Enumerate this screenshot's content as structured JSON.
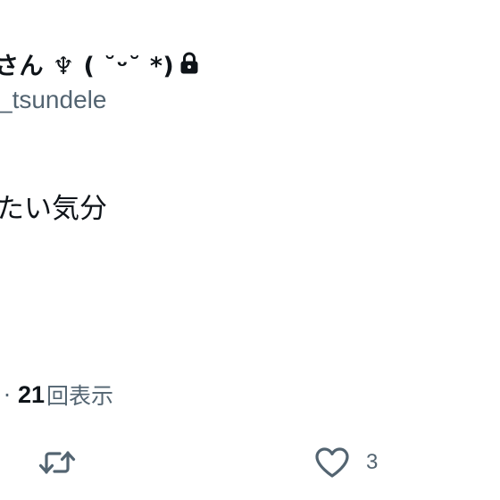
{
  "profile": {
    "display_name": "さん ♆ ( ˘ᵕ˘ *)",
    "handle": "_tsundele",
    "protected_icon": "lock-icon"
  },
  "tweet": {
    "text": "たい気分"
  },
  "meta": {
    "separator": "·",
    "view_count": "21",
    "view_label": "回表示"
  },
  "actions": {
    "retweet_icon": "retweet-icon",
    "like_icon": "heart-icon",
    "like_count": "3"
  },
  "colors": {
    "text_primary": "#0f1419",
    "text_secondary": "#536471",
    "background": "#ffffff"
  }
}
